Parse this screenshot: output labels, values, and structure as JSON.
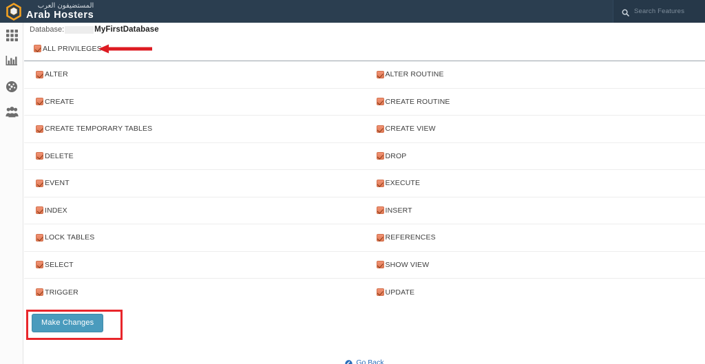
{
  "brand": {
    "arabic_name": "المستضيفون العرب",
    "english_name": "Arab Hosters",
    "logo_icon": "hexagon-ring-logo-icon"
  },
  "search": {
    "placeholder": "Search Features",
    "icon": "search-icon"
  },
  "sidebar": {
    "items": [
      {
        "name": "apps-grid",
        "icon": "grid-icon"
      },
      {
        "name": "statistics",
        "icon": "bar-chart-icon"
      },
      {
        "name": "dashboard",
        "icon": "gauge-icon"
      },
      {
        "name": "users",
        "icon": "users-group-icon"
      }
    ]
  },
  "database_header": {
    "label": "Database:",
    "redacted": true,
    "name": "MyFirstDatabase"
  },
  "all_privileges": {
    "label": "ALL PRIVILEGES",
    "checked": true,
    "annotation_icon": "red-left-arrow-icon"
  },
  "privileges": [
    {
      "left": "ALTER",
      "left_checked": true,
      "right": "ALTER ROUTINE",
      "right_checked": true
    },
    {
      "left": "CREATE",
      "left_checked": true,
      "right": "CREATE ROUTINE",
      "right_checked": true
    },
    {
      "left": "CREATE TEMPORARY TABLES",
      "left_checked": true,
      "right": "CREATE VIEW",
      "right_checked": true
    },
    {
      "left": "DELETE",
      "left_checked": true,
      "right": "DROP",
      "right_checked": true
    },
    {
      "left": "EVENT",
      "left_checked": true,
      "right": "EXECUTE",
      "right_checked": true
    },
    {
      "left": "INDEX",
      "left_checked": true,
      "right": "INSERT",
      "right_checked": true
    },
    {
      "left": "LOCK TABLES",
      "left_checked": true,
      "right": "REFERENCES",
      "right_checked": true
    },
    {
      "left": "SELECT",
      "left_checked": true,
      "right": "SHOW VIEW",
      "right_checked": true
    },
    {
      "left": "TRIGGER",
      "left_checked": true,
      "right": "UPDATE",
      "right_checked": true
    }
  ],
  "actions": {
    "make_changes_label": "Make Changes",
    "go_back_label": "Go Back",
    "go_back_icon": "circle-back-icon",
    "highlight_box": true
  },
  "colors": {
    "header_bg": "#2b3e50",
    "accent_button": "#4a9bbd",
    "checkbox": "#e07a55",
    "annotation_red": "#e8262b",
    "link_blue": "#2a6ebb",
    "logo_orange": "#f0a022"
  }
}
